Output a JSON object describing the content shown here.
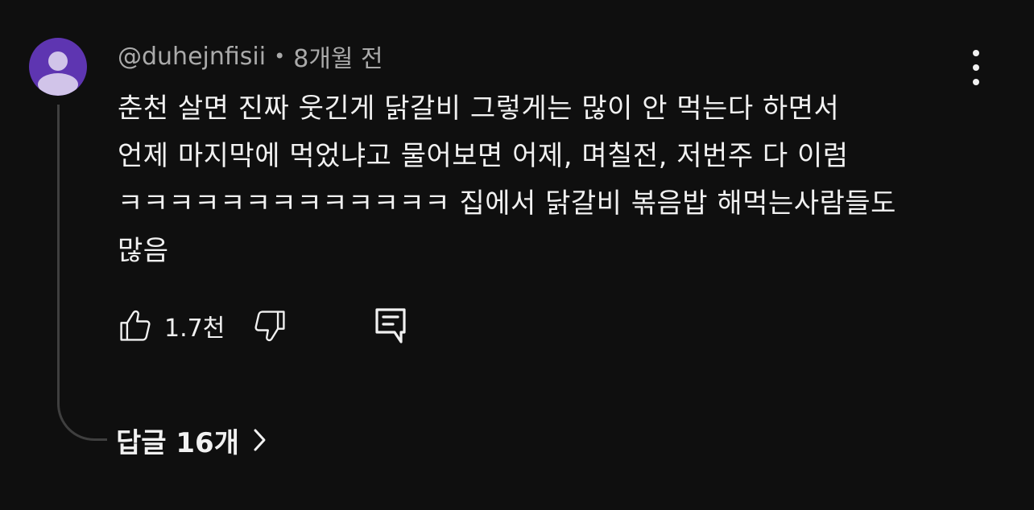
{
  "comment": {
    "author": "@duhejnfisii",
    "separator": "•",
    "time_ago": "8개월 전",
    "text_lines": [
      "춘천 살면 진짜 웃긴게 닭갈비 그렇게는 많이 안 먹는다 하면서",
      "언제 마지막에 먹었냐고 물어보면 어제, 며칠전, 저번주 다 이럼",
      "ㅋㅋㅋㅋㅋㅋㅋㅋㅋㅋㅋㅋㅋ 집에서 닭갈비 볶음밥 해먹는사람들도",
      "많음"
    ],
    "like_count": "1.7천",
    "replies_label": "답글 16개"
  },
  "icons": {
    "avatar": "avatar-default-person-icon",
    "more": "more-vertical-icon",
    "like": "thumbs-up-icon",
    "dislike": "thumbs-down-icon",
    "reply": "reply-comment-icon",
    "expand": "chevron-right-icon"
  },
  "colors": {
    "background": "#0f0f0f",
    "avatar_bg": "#5e35b1",
    "avatar_fg": "#d1c4e9",
    "primary_text": "#f1f1f1",
    "secondary_text": "#aaaaaa",
    "thread_line": "#3f3f3f"
  }
}
